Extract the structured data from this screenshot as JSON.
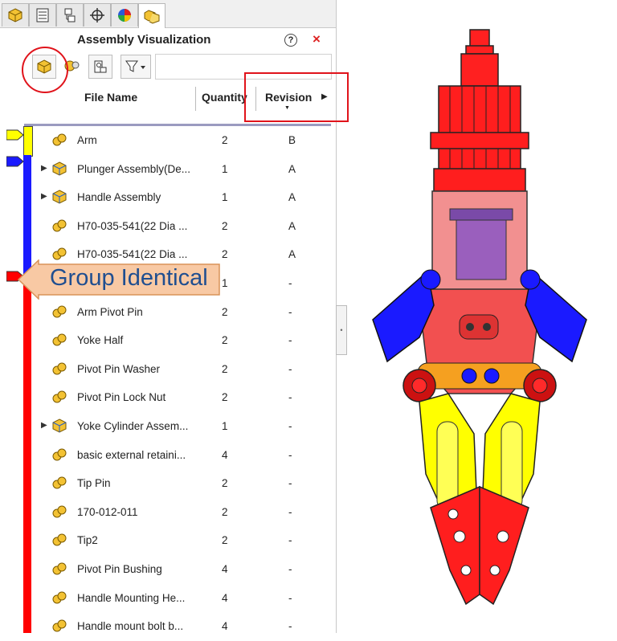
{
  "panel": {
    "title": "Assembly Visualization",
    "help_label": "?",
    "close_label": "×",
    "tabs": [
      "feature-manager-tab",
      "property-manager-tab",
      "configuration-manager-tab",
      "dimxpert-tab",
      "display-manager-tab",
      "assembly-visualization-tab"
    ]
  },
  "columns": {
    "file_name": "File Name",
    "quantity": "Quantity",
    "revision": "Revision"
  },
  "rows": [
    {
      "name": "Arm",
      "qty": "2",
      "rev": "B",
      "type": "part",
      "expandable": false
    },
    {
      "name": "Plunger Assembly(De...",
      "qty": "1",
      "rev": "A",
      "type": "assembly",
      "expandable": true
    },
    {
      "name": "Handle Assembly",
      "qty": "1",
      "rev": "A",
      "type": "assembly",
      "expandable": true
    },
    {
      "name": "H70-035-541(22 Dia ...",
      "qty": "2",
      "rev": "A",
      "type": "part",
      "expandable": false
    },
    {
      "name": "H70-035-541(22 Dia ...",
      "qty": "2",
      "rev": "A",
      "type": "part",
      "expandable": false
    },
    {
      "name": "",
      "qty": "1",
      "rev": "-",
      "type": "part",
      "expandable": false
    },
    {
      "name": "Arm Pivot Pin",
      "qty": "2",
      "rev": "-",
      "type": "part",
      "expandable": false
    },
    {
      "name": "Yoke Half",
      "qty": "2",
      "rev": "-",
      "type": "part",
      "expandable": false
    },
    {
      "name": "Pivot Pin Washer",
      "qty": "2",
      "rev": "-",
      "type": "part",
      "expandable": false
    },
    {
      "name": "Pivot Pin Lock Nut",
      "qty": "2",
      "rev": "-",
      "type": "part",
      "expandable": false
    },
    {
      "name": "Yoke Cylinder Assem...",
      "qty": "1",
      "rev": "-",
      "type": "assembly",
      "expandable": true
    },
    {
      "name": "basic external retaini...",
      "qty": "4",
      "rev": "-",
      "type": "part",
      "expandable": false
    },
    {
      "name": "Tip Pin",
      "qty": "2",
      "rev": "-",
      "type": "part",
      "expandable": false
    },
    {
      "name": "170-012-011",
      "qty": "2",
      "rev": "-",
      "type": "part",
      "expandable": false
    },
    {
      "name": "Tip2",
      "qty": "2",
      "rev": "-",
      "type": "part",
      "expandable": false
    },
    {
      "name": "Pivot Pin Bushing",
      "qty": "4",
      "rev": "-",
      "type": "part",
      "expandable": false
    },
    {
      "name": "Handle Mounting He...",
      "qty": "4",
      "rev": "-",
      "type": "part",
      "expandable": false
    },
    {
      "name": "Handle mount bolt b...",
      "qty": "4",
      "rev": "-",
      "type": "part",
      "expandable": false
    }
  ],
  "callout": {
    "text": "Group Identical"
  },
  "colors": {
    "yellow": "#ffff00",
    "blue": "#1a1aff",
    "red": "#ff0000",
    "callout_fill": "#f8c9a4",
    "annotation_red": "#e0131b"
  }
}
